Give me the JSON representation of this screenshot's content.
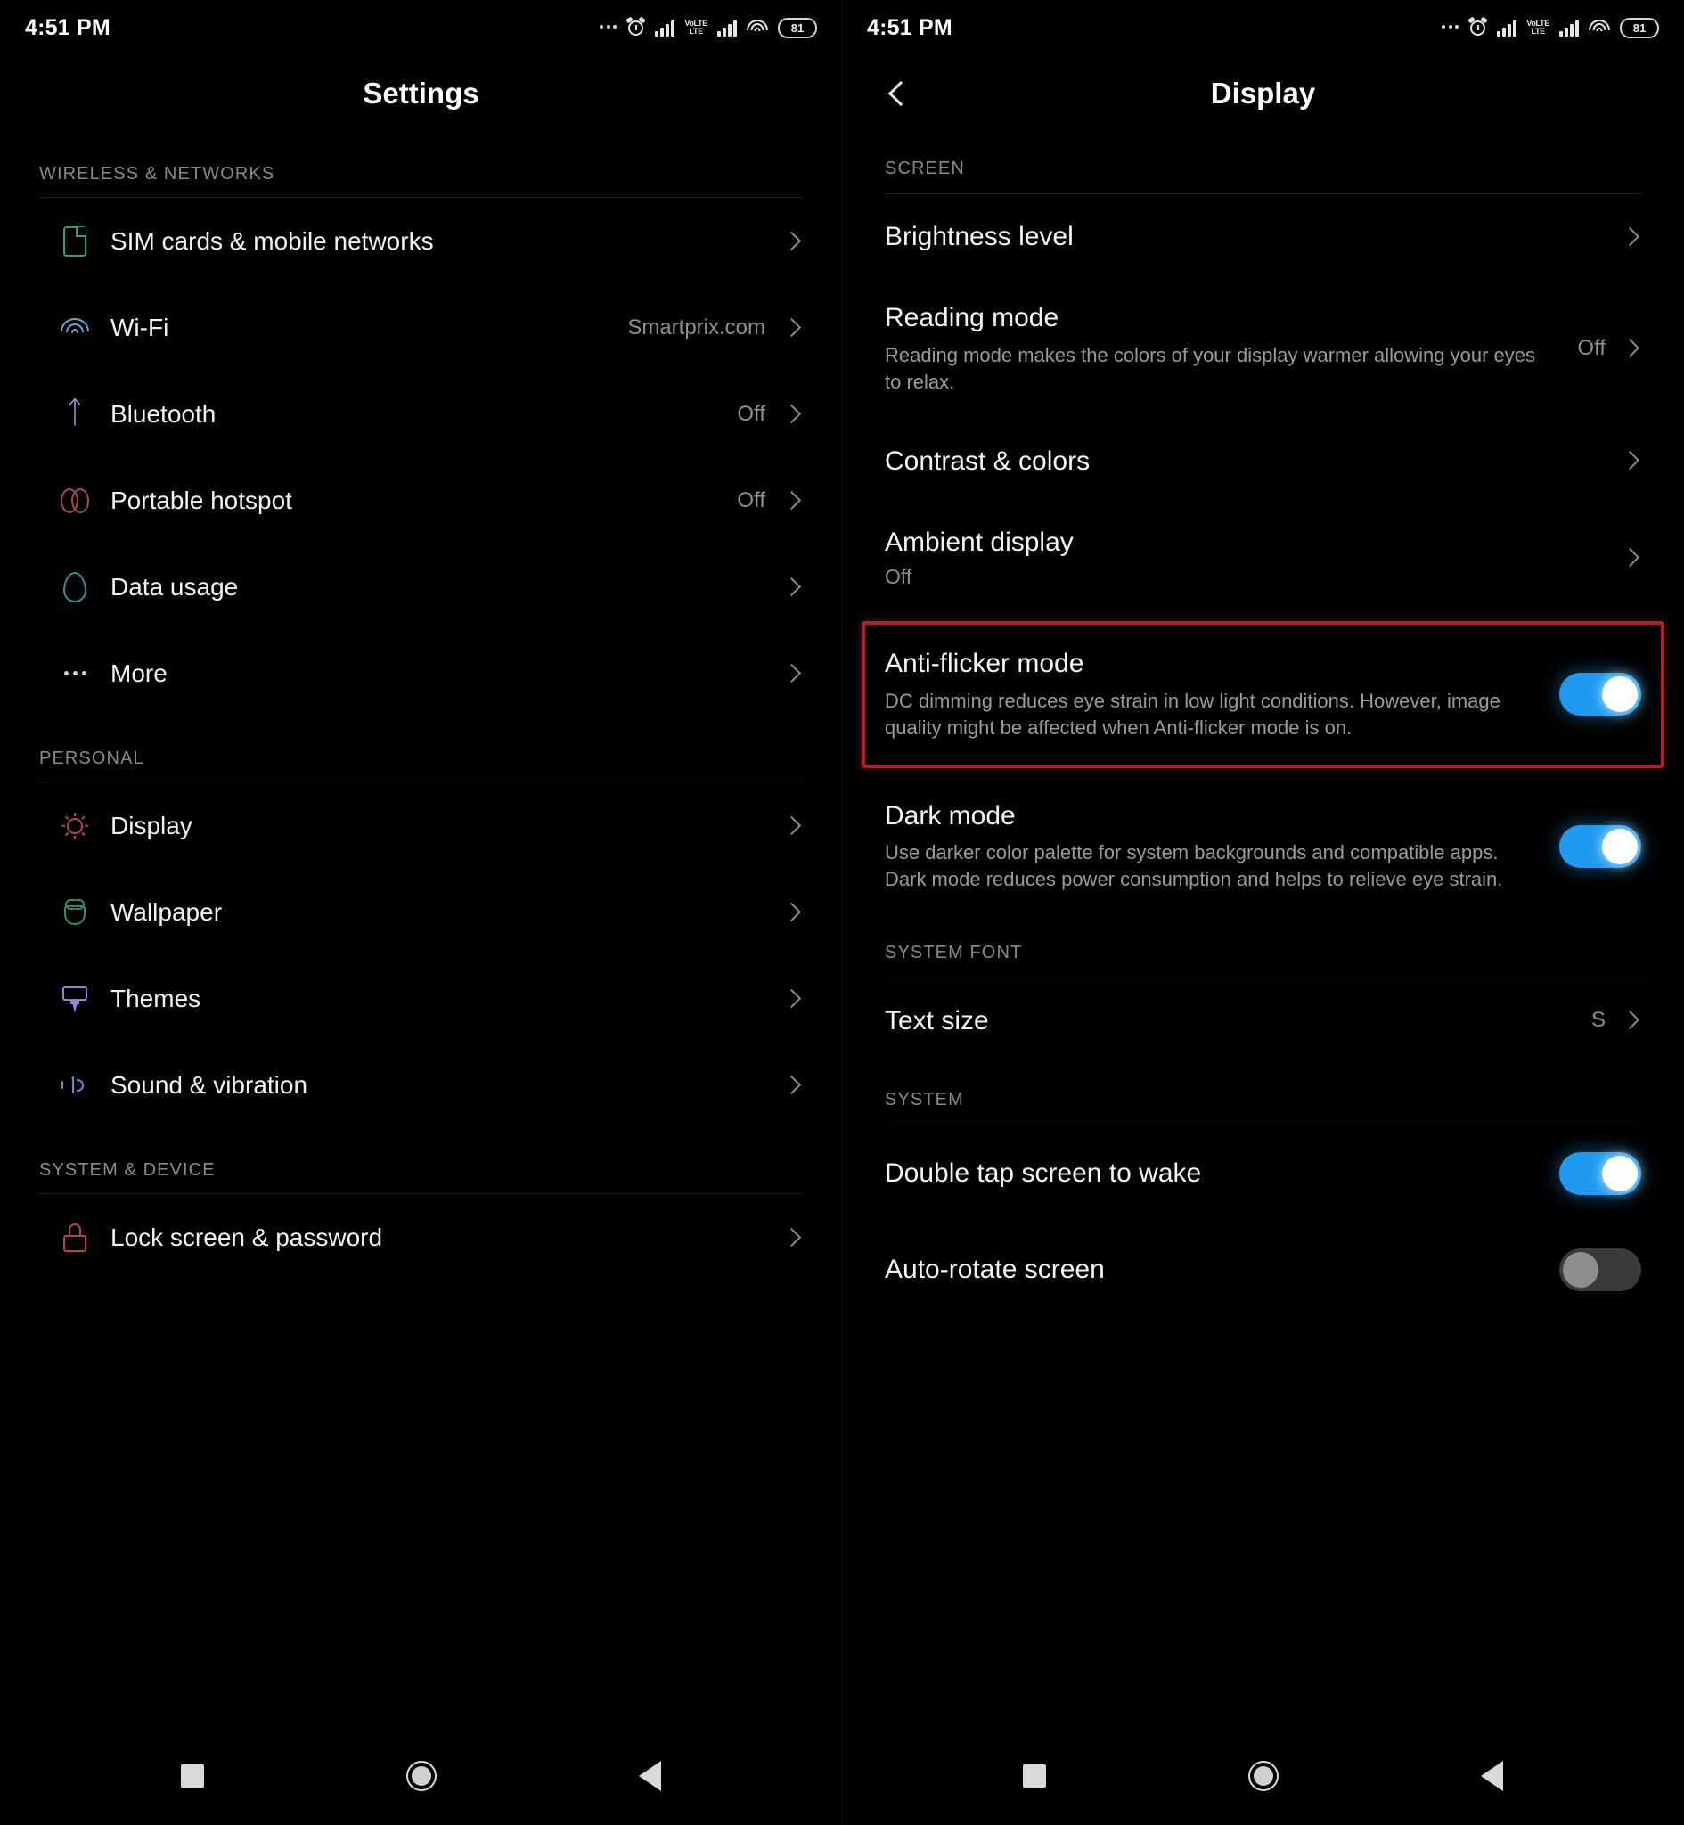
{
  "status_bar": {
    "time": "4:51 PM",
    "battery_level": "81",
    "icons": [
      "more-dots-icon",
      "alarm-clock-icon",
      "signal-bars-icon",
      "volte-lte-icon",
      "signal-bars-2-icon",
      "wifi-icon",
      "battery-icon"
    ],
    "volte_top": "VoLTE",
    "volte_bottom": "LTE"
  },
  "left_screen": {
    "title": "Settings",
    "sections": [
      {
        "label": "WIRELESS & NETWORKS",
        "items": [
          {
            "label": "SIM cards & mobile networks",
            "value": "",
            "icon": "sim-card-icon",
            "icon_color": "#2e9e7e"
          },
          {
            "label": "Wi-Fi",
            "value": "Smartprix.com",
            "icon": "wifi-icon",
            "icon_color": "#63a8d8"
          },
          {
            "label": "Bluetooth",
            "value": "Off",
            "icon": "bluetooth-icon",
            "icon_color": "#a39ee6"
          },
          {
            "label": "Portable hotspot",
            "value": "Off",
            "icon": "hotspot-icon",
            "icon_color": "#a44a50"
          },
          {
            "label": "Data usage",
            "value": "",
            "icon": "water-drop-icon",
            "icon_color": "#2f8f96"
          },
          {
            "label": "More",
            "value": "",
            "icon": "more-dots-icon",
            "icon_color": "#cfcfcf"
          }
        ]
      },
      {
        "label": "PERSONAL",
        "items": [
          {
            "label": "Display",
            "value": "",
            "icon": "brightness-icon",
            "icon_color": "#b6434f"
          },
          {
            "label": "Wallpaper",
            "value": "",
            "icon": "flower-icon",
            "icon_color": "#2f8f62"
          },
          {
            "label": "Themes",
            "value": "",
            "icon": "paint-brush-icon",
            "icon_color": "#8e84d4"
          },
          {
            "label": "Sound & vibration",
            "value": "",
            "icon": "speaker-icon",
            "icon_color": "#5b8fc9"
          }
        ]
      },
      {
        "label": "SYSTEM & DEVICE",
        "items": [
          {
            "label": "Lock screen & password",
            "value": "",
            "icon": "lock-icon",
            "icon_color": "#b64050"
          }
        ]
      }
    ]
  },
  "right_screen": {
    "title": "Display",
    "back_icon": "chevron-left-icon",
    "sections": [
      {
        "label": "SCREEN",
        "items": [
          {
            "title": "Brightness level",
            "desc": "",
            "sub": "",
            "value": "",
            "control": "chevron"
          },
          {
            "title": "Reading mode",
            "desc": "Reading mode makes the colors of your display warmer allowing your eyes to relax.",
            "sub": "",
            "value": "Off",
            "control": "chevron"
          },
          {
            "title": "Contrast & colors",
            "desc": "",
            "sub": "",
            "value": "",
            "control": "chevron"
          },
          {
            "title": "Ambient display",
            "desc": "",
            "sub": "Off",
            "value": "",
            "control": "chevron"
          },
          {
            "title": "Anti-flicker mode",
            "desc": "DC dimming reduces eye strain in low light conditions. However, image quality might be affected when Anti-flicker mode is on.",
            "sub": "",
            "value": "",
            "control": "toggle",
            "toggle_state": "on",
            "highlighted": "true"
          },
          {
            "title": "Dark mode",
            "desc": "Use darker color palette for system backgrounds and compatible apps. Dark mode reduces power consumption and helps to relieve eye strain.",
            "sub": "",
            "value": "",
            "control": "toggle",
            "toggle_state": "on"
          }
        ]
      },
      {
        "label": "SYSTEM FONT",
        "items": [
          {
            "title": "Text size",
            "desc": "",
            "sub": "",
            "value": "S",
            "control": "chevron"
          }
        ]
      },
      {
        "label": "SYSTEM",
        "items": [
          {
            "title": "Double tap screen to wake",
            "desc": "",
            "sub": "",
            "value": "",
            "control": "toggle",
            "toggle_state": "on"
          },
          {
            "title": "Auto-rotate screen",
            "desc": "",
            "sub": "",
            "value": "",
            "control": "toggle",
            "toggle_state": "off"
          }
        ]
      }
    ]
  },
  "nav_bar": {
    "recents": "square-recents-icon",
    "home": "circle-home-icon",
    "back": "triangle-back-icon"
  },
  "colors": {
    "toggle_on": "#1e9bf0",
    "toggle_off": "#3a3a3a",
    "highlight_border": "#b0202c",
    "background": "#000000"
  }
}
